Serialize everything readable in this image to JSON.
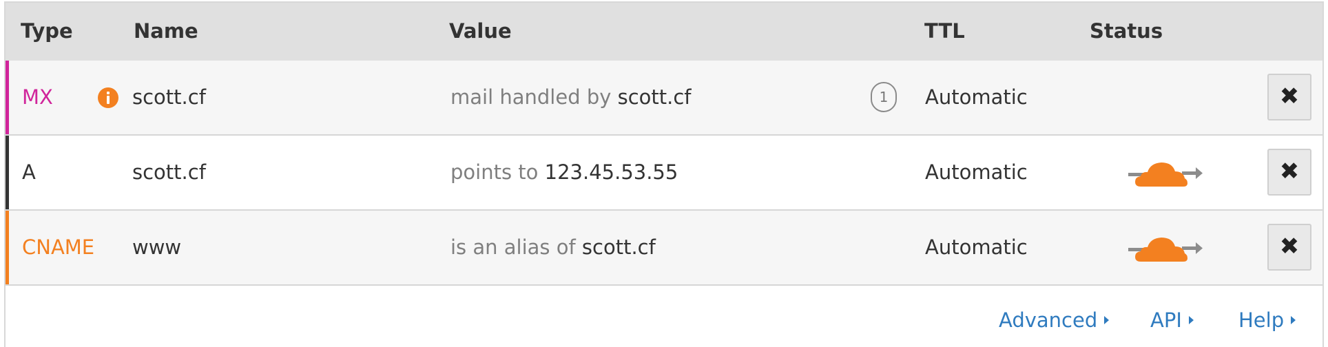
{
  "table": {
    "headers": {
      "type": "Type",
      "name": "Name",
      "value": "Value",
      "ttl": "TTL",
      "status": "Status"
    },
    "rows": [
      {
        "type": "MX",
        "type_color": "#d0259b",
        "stripe_color": "#d0259b",
        "name": "scott.cf",
        "value_prefix": "mail handled by ",
        "value_target": "scott.cf",
        "priority": "1",
        "ttl": "Automatic",
        "status_icon": null,
        "has_info_icon": true,
        "delete_icon": "close-icon"
      },
      {
        "type": "A",
        "type_color": "#333333",
        "stripe_color": "#333333",
        "name": "scott.cf",
        "value_prefix": "points to ",
        "value_target": "123.45.53.55",
        "ttl": "Automatic",
        "status_icon": "orange-cloud-proxied-icon",
        "delete_icon": "close-icon"
      },
      {
        "type": "CNAME",
        "type_color": "#f38020",
        "stripe_color": "#f38020",
        "name": "www",
        "value_prefix": "is an alias of ",
        "value_target": "scott.cf",
        "ttl": "Automatic",
        "status_icon": "orange-cloud-proxied-icon",
        "delete_icon": "close-icon"
      }
    ]
  },
  "footer": {
    "advanced": "Advanced",
    "api": "API",
    "help": "Help"
  },
  "colors": {
    "header_bg": "#e0e0e0",
    "link": "#2f7bbf",
    "cloud_orange": "#f38020",
    "info_orange": "#f38020"
  }
}
